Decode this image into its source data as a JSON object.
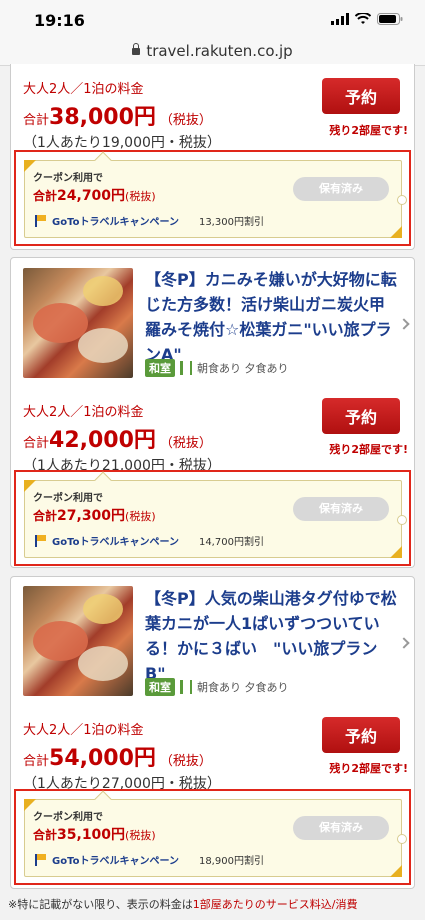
{
  "status": {
    "time": "19:16"
  },
  "browser": {
    "url": "travel.rakuten.co.jp"
  },
  "plans": [
    {
      "title": "",
      "room_type": "",
      "meals": "",
      "plan_label": "大人2人／1泊の料金",
      "total_prefix": "合計",
      "total_price": "38,000円",
      "tax": "（税抜）",
      "per_person": "（1人あたり19,000円・税抜）",
      "reserve_label": "予約",
      "rooms_left": "残り2部屋です!",
      "coupon": {
        "label": "クーポン利用で",
        "total_prefix": "合計",
        "total_price": "24,700円",
        "tax": "(税抜)",
        "saved_label": "保有済み",
        "campaign": "GoToトラベルキャンペーン",
        "discount": "13,300円割引"
      }
    },
    {
      "title": "【冬P】カニみそ嫌いが大好物に転じた方多数！活け柴山ガニ炭火甲羅みそ焼付☆松葉ガニ\"いい旅プランA\"",
      "room_type": "和室",
      "meals": "朝食あり 夕食あり",
      "plan_label": "大人2人／1泊の料金",
      "total_prefix": "合計",
      "total_price": "42,000円",
      "tax": "（税抜）",
      "per_person": "（1人あたり21,000円・税抜）",
      "reserve_label": "予約",
      "rooms_left": "残り2部屋です!",
      "coupon": {
        "label": "クーポン利用で",
        "total_prefix": "合計",
        "total_price": "27,300円",
        "tax": "(税抜)",
        "saved_label": "保有済み",
        "campaign": "GoToトラベルキャンペーン",
        "discount": "14,700円割引"
      }
    },
    {
      "title": "【冬P】人気の柴山港タグ付ゆで松葉カニが一人1ぱいずつついている！かに３ばい　\"いい旅プランB\"",
      "room_type": "和室",
      "meals": "朝食あり 夕食あり",
      "plan_label": "大人2人／1泊の料金",
      "total_prefix": "合計",
      "total_price": "54,000円",
      "tax": "（税抜）",
      "per_person": "（1人あたり27,000円・税抜）",
      "reserve_label": "予約",
      "rooms_left": "残り2部屋です!",
      "coupon": {
        "label": "クーポン利用で",
        "total_prefix": "合計",
        "total_price": "35,100円",
        "tax": "(税抜)",
        "saved_label": "保有済み",
        "campaign": "GoToトラベルキャンペーン",
        "discount": "18,900円割引"
      }
    }
  ],
  "footer": {
    "note_a": "※特に記載がない限り、表示の料金は",
    "note_b": "1部屋あたりのサービス料込/消費"
  },
  "colors": {
    "accent_red": "#bf0000",
    "link_blue": "#1c3d8c",
    "highlight_outline": "#e0261a"
  }
}
